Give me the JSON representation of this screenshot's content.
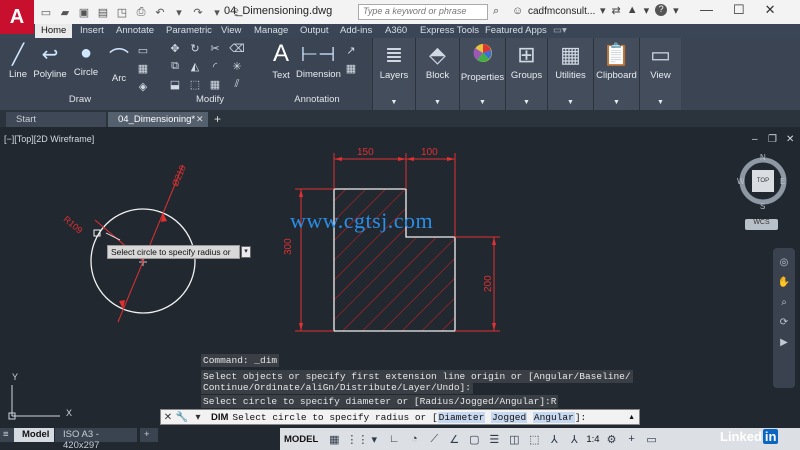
{
  "app": {
    "logo_letter": "A"
  },
  "titlebar": {
    "document": "04_Dimensioning.dwg",
    "search_placeholder": "Type a keyword or phrase",
    "user": "cadfmconsult...",
    "help": "?"
  },
  "ribbon_tabs": [
    "Home",
    "Insert",
    "Annotate",
    "Parametric",
    "View",
    "Manage",
    "Output",
    "Add-ins",
    "A360",
    "Express Tools",
    "Featured Apps"
  ],
  "ribbon": {
    "draw": {
      "title": "Draw",
      "buttons": [
        "Line",
        "Polyline",
        "Circle",
        "Arc"
      ]
    },
    "modify": {
      "title": "Modify"
    },
    "annotation": {
      "title": "Annotation",
      "buttons": [
        "Text",
        "Dimension"
      ]
    },
    "big": [
      "Layers",
      "Block",
      "Properties",
      "Groups",
      "Utilities",
      "Clipboard",
      "View"
    ]
  },
  "doc_tabs": [
    "Start",
    "04_Dimensioning*"
  ],
  "viewport": {
    "label": "[−][Top][2D Wireframe]"
  },
  "drawing": {
    "dims": {
      "top_left": "150",
      "top_right": "100",
      "left": "300",
      "right": "200",
      "circle_diameter": "Ø218",
      "circle_radius": "R109"
    }
  },
  "watermark": "www.cgtsj.com",
  "viewcube": {
    "n": "N",
    "s": "S",
    "e": "E",
    "w": "W",
    "top": "TOP",
    "wcs": "WCS"
  },
  "tooltip": {
    "text": "Select circle to specify radius or"
  },
  "command_history": [
    "Command: _dim",
    "Select objects or specify first extension line origin or [Angular/Baseline/",
    "Continue/Ordinate/aliGn/Distribute/Layer/Undo]:",
    "Select circle to specify diameter or [Radius/Jogged/Angular]:R"
  ],
  "command_input": {
    "keyword": "DIM",
    "prompt": "Select circle to specify radius or [",
    "options": [
      "Diameter",
      "Jogged",
      "Angular"
    ],
    "suffix": "]:"
  },
  "layout_tabs": [
    "Model",
    "ISO A3 - 420x297"
  ],
  "status": {
    "model": "MODEL",
    "scale": "1:4"
  },
  "ucs": {
    "x": "X",
    "y": "Y"
  },
  "brand": {
    "linked": "Linked",
    "in": "in"
  }
}
